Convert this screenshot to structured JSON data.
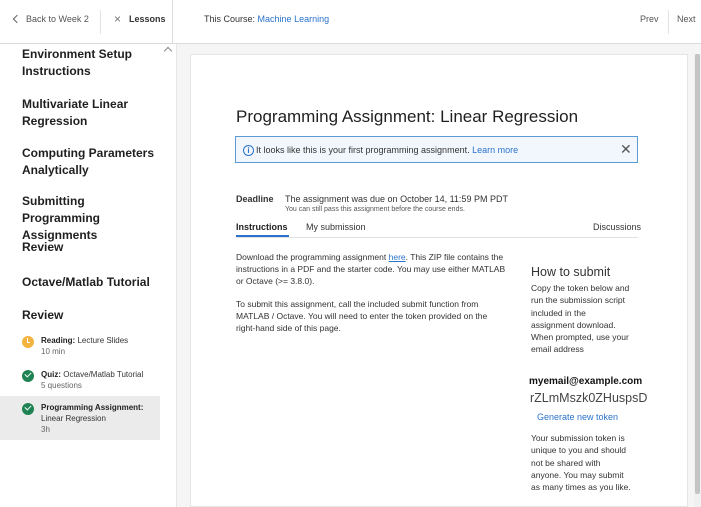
{
  "topbar": {
    "back_label": "Back to Week 2",
    "lessons_label": "Lessons",
    "course_prefix": "This Course:",
    "course_name": "Machine Learning",
    "prev_label": "Prev",
    "next_label": "Next"
  },
  "sidebar": {
    "headings": [
      "Environment Setup Instructions",
      "Multivariate Linear Regression",
      "Computing Parameters Analytically",
      "Submitting Programming Assignments",
      "Review",
      "Octave/Matlab Tutorial",
      "Review"
    ],
    "items": [
      {
        "type": "Reading:",
        "title": "Lecture Slides",
        "meta": "10 min",
        "status": "in-progress"
      },
      {
        "type": "Quiz:",
        "title": "Octave/Matlab Tutorial",
        "meta": "5 questions",
        "status": "complete"
      },
      {
        "type": "Programming Assignment:",
        "title": "Linear Regression",
        "meta": "3h",
        "status": "complete"
      }
    ]
  },
  "main": {
    "title": "Programming Assignment: Linear Regression",
    "banner": {
      "message": "It looks like this is your first programming assignment.",
      "link": "Learn more"
    },
    "deadline": {
      "label": "Deadline",
      "text": "The assignment was due on October 14, 11:59 PM PDT",
      "sub": "You can still pass this assignment before the course ends."
    },
    "tabs": {
      "instructions": "Instructions",
      "submission": "My submission",
      "discussions": "Discussions"
    },
    "para1": {
      "before": "Download the programming assignment ",
      "link": "here",
      "after": ". This ZIP file contains the instructions in a PDF and the starter code. You may use either MATLAB or Octave (>= 3.8.0)."
    },
    "para2": "To submit this assignment, call the included submit function from MATLAB / Octave. You will need to enter the token provided on the right-hand side of this page."
  },
  "submit": {
    "title": "How to submit",
    "instructions": "Copy the token below and run the submission script included in the assignment download. When prompted, use your email address",
    "email": "myemail@example.com",
    "token": "rZLmMszk0ZHuspsD",
    "generate_label": "Generate new token",
    "note": "Your submission token is unique to you and should not be shared with anyone. You may submit as many times as you like."
  },
  "colors": {
    "accent": "#2a73cc",
    "complete": "#1f8354",
    "in_progress": "#f3b43f"
  }
}
